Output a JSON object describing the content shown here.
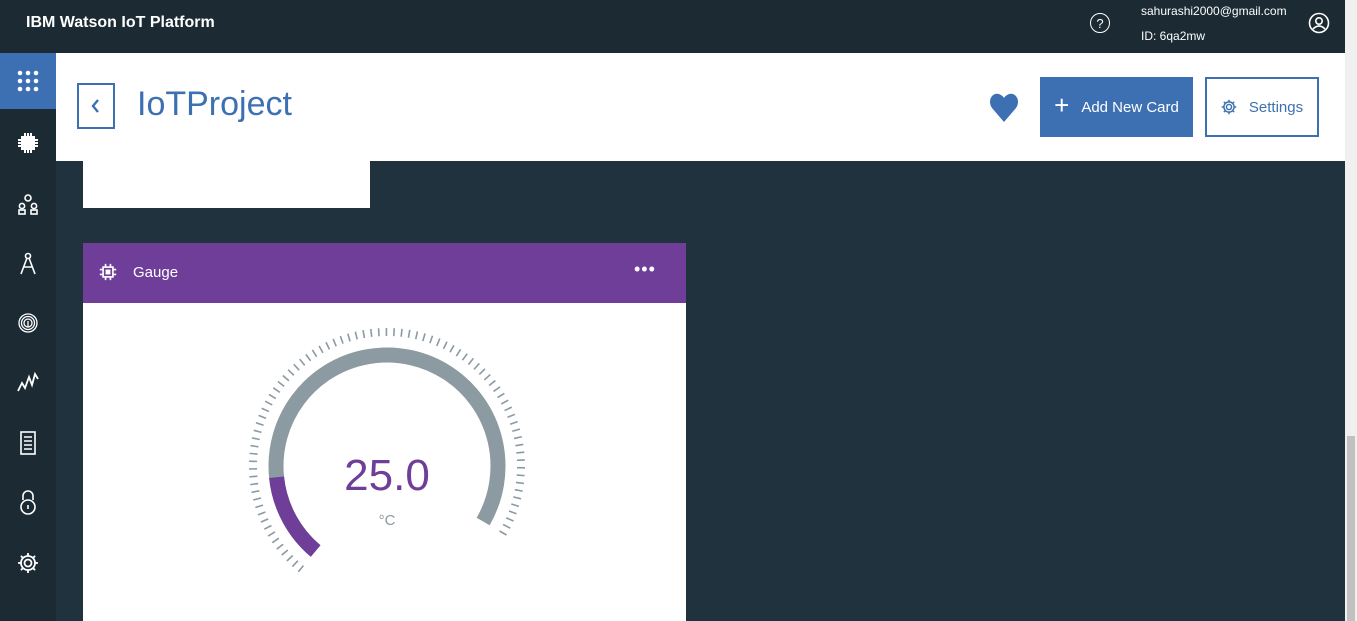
{
  "app": {
    "title": "IBM Watson IoT Platform"
  },
  "user": {
    "email": "sahurashi2000@gmail.com",
    "id_label": "ID: 6qa2mw"
  },
  "topbar": {
    "help_glyph": "?"
  },
  "sidebar": {
    "items": [
      {
        "icon": "apps-grid-icon",
        "active": true
      },
      {
        "icon": "device-chip-icon"
      },
      {
        "icon": "members-icon"
      },
      {
        "icon": "compass-icon"
      },
      {
        "icon": "fingerprint-icon"
      },
      {
        "icon": "analytics-icon"
      },
      {
        "icon": "document-icon"
      },
      {
        "icon": "security-lock-icon"
      },
      {
        "icon": "gear-icon"
      }
    ]
  },
  "header": {
    "back_glyph": "‹",
    "title": "IoTProject",
    "add_card_label": "Add New Card",
    "settings_label": "Settings"
  },
  "gauge_card": {
    "title": "Gauge",
    "menu_glyph": "•••",
    "value": "25.0",
    "unit": "°C",
    "fill_fraction": 0.17
  },
  "colors": {
    "accent": "#3d70b2",
    "gauge_header": "#6e3e99",
    "gauge_fill": "#6e3e99",
    "gauge_track": "#8c9aa2",
    "background": "#1f323d",
    "topbar": "#1b2a33"
  }
}
